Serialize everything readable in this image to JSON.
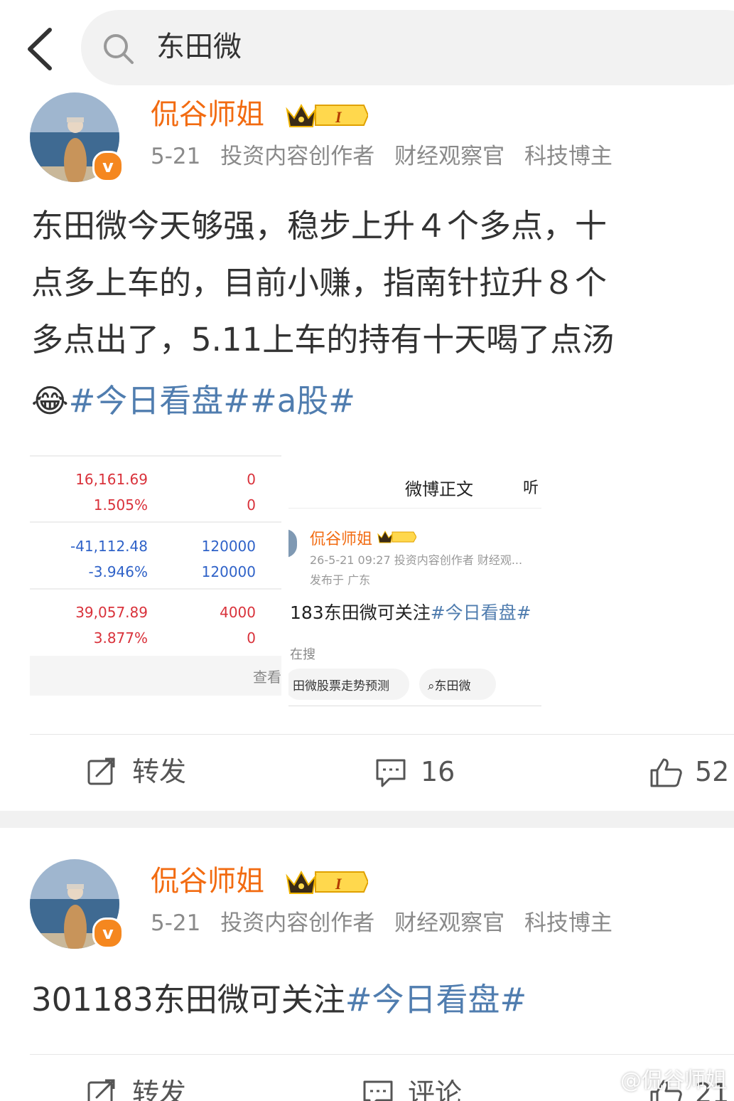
{
  "search": {
    "query": "东田微"
  },
  "posts": [
    {
      "author": "侃谷师姐",
      "level": "I",
      "meta": {
        "date": "5-21",
        "roles": [
          "投资内容创作者",
          "财经观察官",
          "科技博主"
        ]
      },
      "lines": [
        "东田微今天够强，稳步上升４个多点，十",
        "点多上车的，目前小赚，指南针拉升８个",
        "多点出了，5.11上车的持有十天喝了点汤"
      ],
      "emoji": "😂",
      "tags": [
        "#今日看盘#",
        "#a股#"
      ],
      "actions": {
        "repost": "转发",
        "comments": "16",
        "likes": "52"
      }
    },
    {
      "author": "侃谷师姐",
      "level": "I",
      "meta": {
        "date": "5-21",
        "roles": [
          "投资内容创作者",
          "财经观察官",
          "科技博主"
        ]
      },
      "text": "301183东田微可关注",
      "tags": [
        "#今日看盘#"
      ],
      "actions": {
        "repost": "转发",
        "comment": "评论",
        "likes": "21"
      }
    }
  ],
  "image1": {
    "groups": [
      {
        "v1": "16,161.69",
        "w1": "0",
        "v2": "1.505%",
        "w2": "0",
        "color": "#d9323b"
      },
      {
        "v1": "-41,112.48",
        "w1": "120000",
        "v2": "-3.946%",
        "w2": "120000",
        "color": "#2f62c8"
      },
      {
        "v1": "39,057.89",
        "w1": "4000",
        "v2": "3.877%",
        "w2": "0",
        "color": "#d9323b"
      }
    ],
    "footer": "查看"
  },
  "image2": {
    "header": "微博正文",
    "header_right": "听",
    "author": "侃谷师姐",
    "meta": "26-5-21 09:27  投资内容创作者 财经观...",
    "location": "发布于 广东",
    "text": "183东田微可关注",
    "tag": "#今日看盘#",
    "searching": "在搜",
    "chip1": "田微股票走势预测",
    "chip2": "东田微"
  },
  "watermark": "@侃谷师姐",
  "colors": {
    "orange": "#f26b11",
    "link": "#507daf",
    "gray": "#8a8a8a"
  }
}
